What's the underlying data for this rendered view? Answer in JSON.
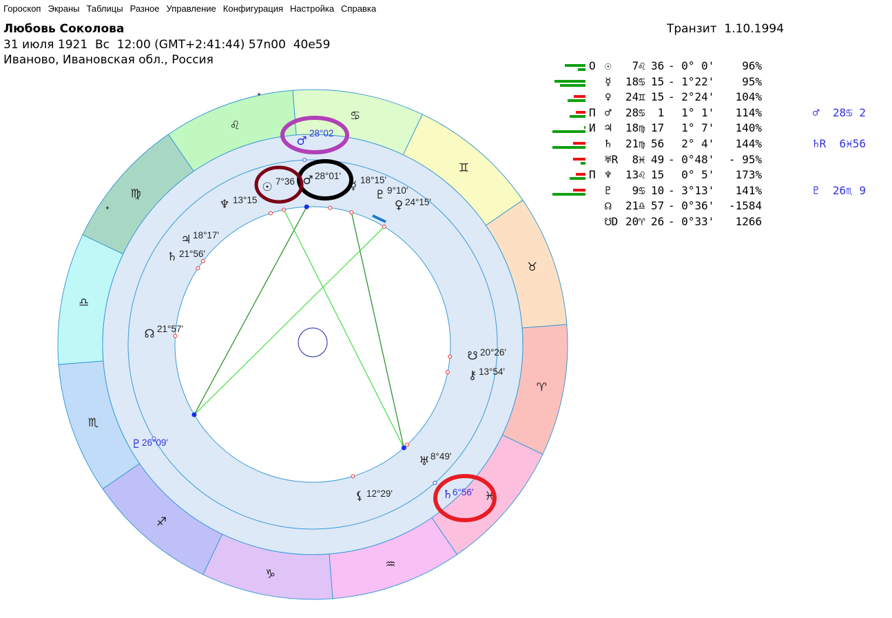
{
  "menu": [
    "Гороскоп",
    "Экраны",
    "Таблицы",
    "Разное",
    "Управление",
    "Конфигурация",
    "Настройка",
    "Справка"
  ],
  "header": {
    "name": "Любовь Соколова",
    "birth_line": "31 июля 1921  Вс  12:00 (GMT+2:41:44) 57n00  40e59",
    "place": "Иваново, Ивановская обл., Россия",
    "transit": "Транзит  1.10.1994"
  },
  "colors": {
    "accent_blue": "#3030e0",
    "ring": "#dde9f7",
    "line": "#3a9ad6",
    "aspect_dark": "#1f8a1f",
    "aspect_light": "#3fe03f"
  },
  "zodiac": [
    {
      "sign": "cancer",
      "glyph": "♋",
      "color": "#defbcc"
    },
    {
      "sign": "gemini",
      "glyph": "♊",
      "color": "#f9fbc2"
    },
    {
      "sign": "taurus",
      "glyph": "♉",
      "color": "#fde0c4"
    },
    {
      "sign": "aries",
      "glyph": "♈",
      "color": "#fbc0bc"
    },
    {
      "sign": "pisces",
      "glyph": "♓",
      "color": "#fcc0de"
    },
    {
      "sign": "aquarius",
      "glyph": "♒",
      "color": "#f8c0f4"
    },
    {
      "sign": "capricorn",
      "glyph": "♑",
      "color": "#e0c4f8"
    },
    {
      "sign": "sagittarius",
      "glyph": "♐",
      "color": "#c0c0f8"
    },
    {
      "sign": "scorpio",
      "glyph": "♏",
      "color": "#c0dcf8"
    },
    {
      "sign": "libra",
      "glyph": "♎",
      "color": "#c0f8f8"
    },
    {
      "sign": "virgo",
      "glyph": "♍",
      "color": "#a8d8c4"
    },
    {
      "sign": "leo",
      "glyph": "♌",
      "color": "#c0f8c0"
    }
  ],
  "natal": [
    {
      "id": "sun",
      "glyph": "☉",
      "label": "7°36",
      "lon": 127.6
    },
    {
      "id": "mars",
      "glyph": "♂",
      "label": "28°01'",
      "lon": 118.0
    },
    {
      "id": "mercury",
      "glyph": "☿",
      "label": "18°15'",
      "lon": 108.25
    },
    {
      "id": "pluto",
      "glyph": "♇",
      "label": "9°10'",
      "lon": 99.17
    },
    {
      "id": "venus",
      "glyph": "♀",
      "label": "24°15'",
      "lon": 84.25
    },
    {
      "id": "neptune",
      "glyph": "♆",
      "label": "13°15",
      "lon": 133.25
    },
    {
      "id": "jupiter",
      "glyph": "♃",
      "label": "18°17'",
      "lon": 168.28
    },
    {
      "id": "saturn",
      "glyph": "♄",
      "label": "21°56'",
      "lon": 171.93
    },
    {
      "id": "node",
      "glyph": "☊",
      "label": "21°57'",
      "lon": 201.95
    },
    {
      "id": "southnode",
      "glyph": "☋",
      "label": "20°26'",
      "lon": 20.43
    },
    {
      "id": "chiron",
      "glyph": "⚷",
      "label": "13°54'",
      "lon": 13.9
    },
    {
      "id": "uranus",
      "glyph": "♅",
      "label": "8°49'",
      "lon": 338.82
    },
    {
      "id": "lilith",
      "glyph": "⚸",
      "label": "12°29'",
      "lon": 312.48
    }
  ],
  "transits": [
    {
      "id": "t-mars",
      "glyph": "♂",
      "label": "28°02",
      "lon": 118.03
    },
    {
      "id": "t-pluto",
      "glyph": "♇",
      "label": "26°09'",
      "lon": 236.15
    },
    {
      "id": "t-saturn",
      "glyph": "♄",
      "label": "6°56'",
      "lon": 336.93
    }
  ],
  "aspects": [
    {
      "from": "mars",
      "to": "t-pluto",
      "color": "#1f8a1f"
    },
    {
      "from": "sun",
      "to": "t-saturn",
      "color": "#3fe03f"
    },
    {
      "from": "pluto",
      "to": "t-saturn",
      "color": "#1f8a1f"
    },
    {
      "from": "venus",
      "to": "t-pluto",
      "color": "#3fe03f"
    }
  ],
  "table": [
    {
      "mark": "О",
      "glyph": "☉",
      "deg": " 7",
      "sign": "♌",
      "min": "36",
      "orb": "- 0° 0'",
      "pct": "  96%",
      "tr": "",
      "bars": [
        [
          "#10a010",
          0.6
        ],
        [
          "#10a010",
          0.22
        ]
      ]
    },
    {
      "mark": "",
      "glyph": "☿",
      "deg": "18",
      "sign": "♋",
      "min": "15",
      "orb": "- 1°22'",
      "pct": "  95%",
      "tr": "",
      "bars": [
        [
          "#10a010",
          0.9
        ],
        [
          "#10a010",
          0.75
        ]
      ]
    },
    {
      "mark": "",
      "glyph": "♀",
      "deg": "24",
      "sign": "♊",
      "min": "15",
      "orb": "- 2°24'",
      "pct": " 104%",
      "tr": "",
      "bars": [
        [
          "#f01010",
          0.34
        ],
        [
          "#10a010",
          0.52
        ]
      ]
    },
    {
      "mark": "П",
      "glyph": "♂",
      "deg": "28",
      "sign": "♋",
      "min": " 1",
      "orb": "  1° 1'",
      "pct": " 114%",
      "tr": "♂  28♋ 2",
      "bars": [
        [
          "#f01010",
          0.28
        ],
        [
          "#10a010",
          0.46
        ]
      ]
    },
    {
      "mark": "И",
      "glyph": "♃",
      "deg": "18",
      "sign": "♍",
      "min": "17",
      "orb": "  1° 7'",
      "pct": " 140%",
      "tr": "",
      "bars": [
        [
          "#10a010",
          0.04
        ],
        [
          "#10a010",
          0.97
        ]
      ]
    },
    {
      "mark": "",
      "glyph": "♄",
      "deg": "21",
      "sign": "♍",
      "min": "56",
      "orb": "  2° 4'",
      "pct": " 144%",
      "tr": "♄R  6♓56",
      "bars": [
        [
          "#f01010",
          0.37
        ],
        [
          "#10a010",
          0.97
        ]
      ]
    },
    {
      "mark": "",
      "glyph": "♅R",
      "deg": " 8",
      "sign": "♓",
      "min": "49",
      "orb": "- 0°48'",
      "pct": "- 95%",
      "tr": "",
      "bars": [
        [
          "#f01010",
          0.37
        ],
        [
          "#10a010",
          0.14
        ]
      ]
    },
    {
      "mark": "П",
      "glyph": "♆",
      "deg": "13",
      "sign": "♌",
      "min": "15",
      "orb": "  0° 5'",
      "pct": " 173%",
      "tr": "",
      "bars": [
        [
          "#f01010",
          0.28
        ],
        [
          "#10a010",
          0.46
        ]
      ]
    },
    {
      "mark": "",
      "glyph": "♇",
      "deg": " 9",
      "sign": "♋",
      "min": "10",
      "orb": "- 3°13'",
      "pct": " 141%",
      "tr": "♇  26♏ 9",
      "bars": [
        [
          "#f01010",
          0.37
        ],
        [
          "#10a010",
          0.97
        ]
      ]
    },
    {
      "mark": "",
      "glyph": "☊",
      "deg": "21",
      "sign": "♎",
      "min": "57",
      "orb": "- 0°36'",
      "pct": "-1584",
      "tr": "",
      "bars": []
    },
    {
      "mark": "",
      "glyph": "☋D",
      "deg": "20",
      "sign": "♈",
      "min": "26",
      "orb": "- 0°33'",
      "pct": " 1266",
      "tr": "",
      "bars": []
    }
  ]
}
